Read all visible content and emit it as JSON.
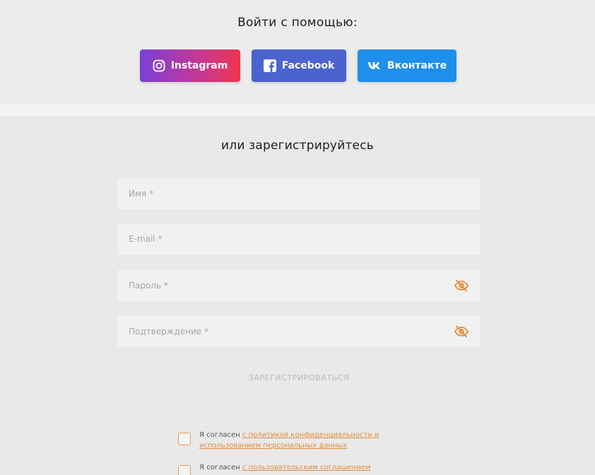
{
  "social": {
    "title": "Войти с помощью:",
    "buttons": [
      {
        "label": "Instagram",
        "icon": "instagram-icon"
      },
      {
        "label": "Facebook",
        "icon": "facebook-icon"
      },
      {
        "label": "Вконтакте",
        "icon": "vk-icon"
      }
    ]
  },
  "register": {
    "title": "или зарегистрируйтесь",
    "fields": {
      "name_placeholder": "Имя *",
      "email_placeholder": "E-mail *",
      "password_placeholder": "Пароль *",
      "confirm_placeholder": "Подтверждение *"
    },
    "submit_label": "ЗАРЕГИСТРИРОВАТЬСЯ",
    "consents": [
      {
        "prefix": "Я согласен ",
        "link": "с политикой конфиденциальности и использованием персональных данных"
      },
      {
        "prefix": "Я согласен ",
        "link": "с пользовательским соглашением"
      }
    ]
  },
  "colors": {
    "instagram_gradient": [
      "#7b3fd6",
      "#f0344f"
    ],
    "facebook": "#4b63cf",
    "vk": "#1f8fec",
    "accent": "#e28b3a"
  }
}
